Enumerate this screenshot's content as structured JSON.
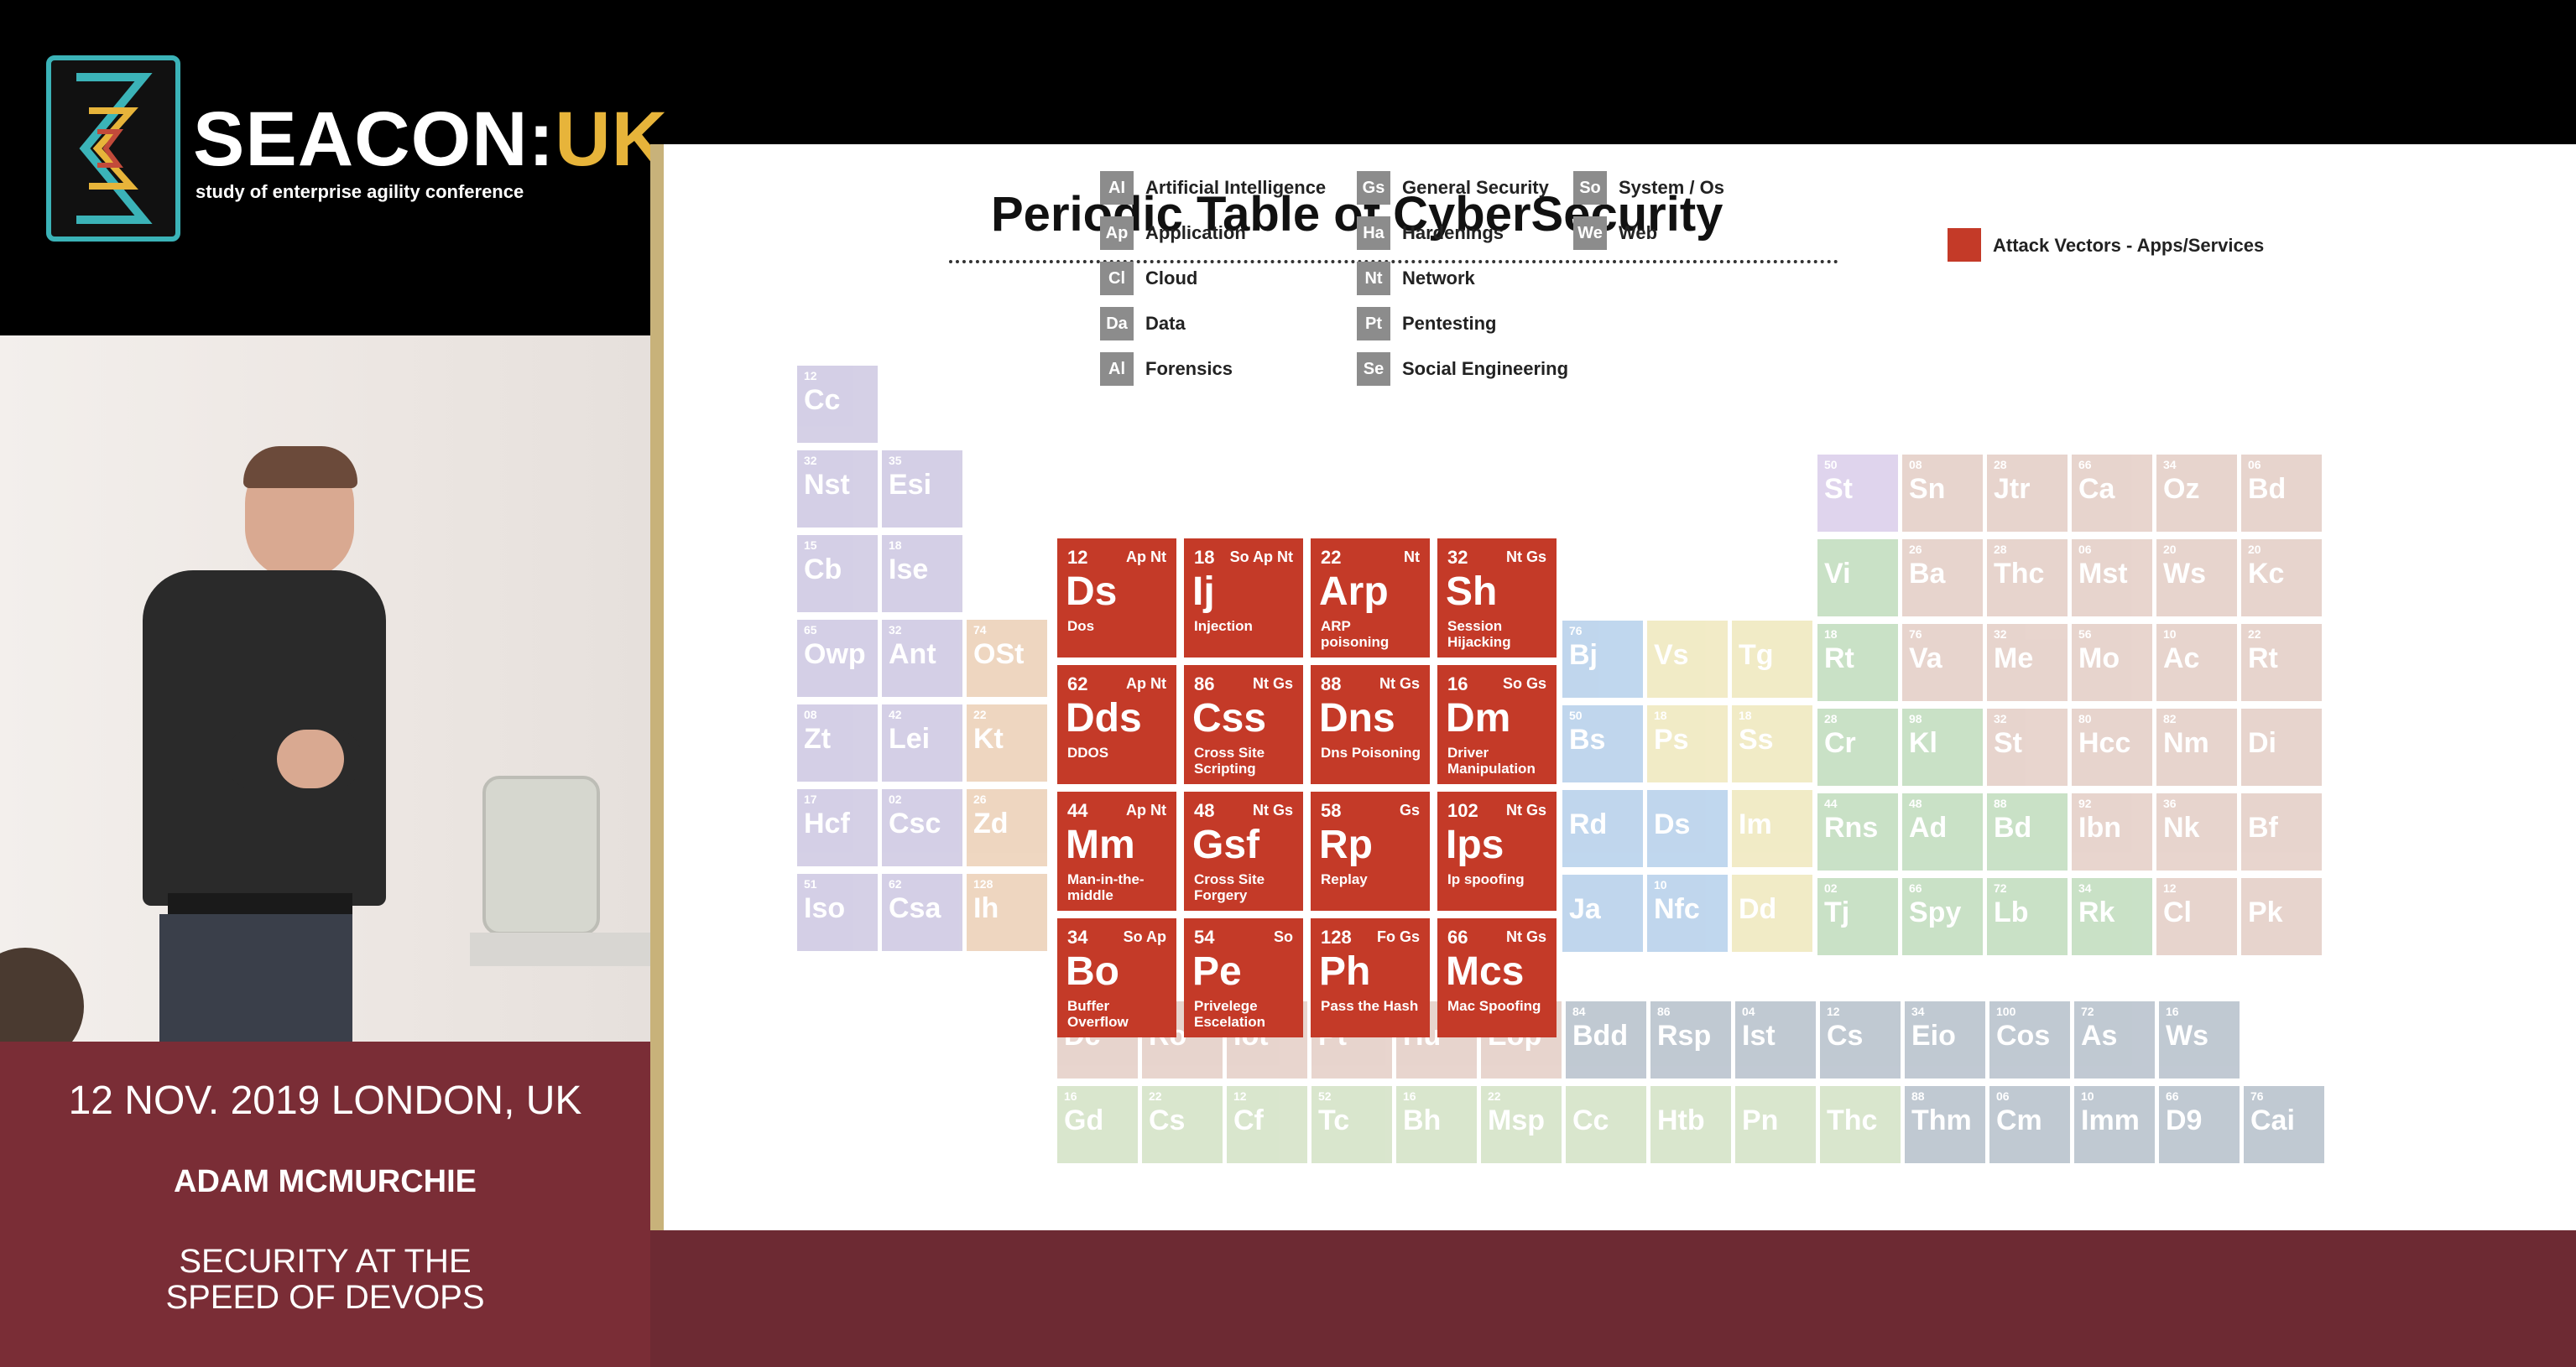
{
  "logo": {
    "brand_main": "SEACON:",
    "brand_accent": "UK",
    "tagline": "study of enterprise agility conference"
  },
  "footer": {
    "date_location": "12 NOV. 2019 LONDON, UK",
    "speaker": "ADAM MCMURCHIE",
    "talk_line1": "SECURITY AT THE",
    "talk_line2": "SPEED OF DEVOPS"
  },
  "slide": {
    "title": "Periodic Table of CyberSecurity",
    "legend_label": "Attack Vectors - Apps/Services",
    "legend_color": "#c43a28",
    "keys": [
      {
        "abbr": "AI",
        "label": "Artificial Intelligence"
      },
      {
        "abbr": "Ap",
        "label": "Application"
      },
      {
        "abbr": "Cl",
        "label": "Cloud"
      },
      {
        "abbr": "Da",
        "label": "Data"
      },
      {
        "abbr": "Al",
        "label": "Forensics"
      },
      {
        "abbr": "Gs",
        "label": "General Security"
      },
      {
        "abbr": "Ha",
        "label": "Hardenings"
      },
      {
        "abbr": "Nt",
        "label": "Network"
      },
      {
        "abbr": "Pt",
        "label": "Pentesting"
      },
      {
        "abbr": "Se",
        "label": "Social Engineering"
      },
      {
        "abbr": "So",
        "label": "System / Os"
      },
      {
        "abbr": "We",
        "label": "Web"
      }
    ],
    "attack_vectors": [
      {
        "num": "12",
        "groups": "Ap Nt",
        "sym": "Ds",
        "name": "Dos"
      },
      {
        "num": "18",
        "groups": "So Ap Nt",
        "sym": "Ij",
        "name": "Injection"
      },
      {
        "num": "22",
        "groups": "Nt",
        "sym": "Arp",
        "name": "ARP poisoning"
      },
      {
        "num": "32",
        "groups": "Nt Gs",
        "sym": "Sh",
        "name": "Session Hijacking"
      },
      {
        "num": "62",
        "groups": "Ap Nt",
        "sym": "Dds",
        "name": "DDOS"
      },
      {
        "num": "86",
        "groups": "Nt Gs",
        "sym": "Css",
        "name": "Cross Site Scripting"
      },
      {
        "num": "88",
        "groups": "Nt Gs",
        "sym": "Dns",
        "name": "Dns Poisoning"
      },
      {
        "num": "16",
        "groups": "So Gs",
        "sym": "Dm",
        "name": "Driver Manipulation"
      },
      {
        "num": "44",
        "groups": "Ap Nt",
        "sym": "Mm",
        "name": "Man-in-the-middle"
      },
      {
        "num": "48",
        "groups": "Nt Gs",
        "sym": "Gsf",
        "name": "Cross Site Forgery"
      },
      {
        "num": "58",
        "groups": "Gs",
        "sym": "Rp",
        "name": "Replay"
      },
      {
        "num": "102",
        "groups": "Nt Gs",
        "sym": "Ips",
        "name": "Ip spoofing"
      },
      {
        "num": "34",
        "groups": "So Ap",
        "sym": "Bo",
        "name": "Buffer Overflow"
      },
      {
        "num": "54",
        "groups": "So",
        "sym": "Pe",
        "name": "Privelege Escelation"
      },
      {
        "num": "128",
        "groups": "Fo Gs",
        "sym": "Ph",
        "name": "Pass the Hash"
      },
      {
        "num": "66",
        "groups": "Nt Gs",
        "sym": "Mcs",
        "name": "Mac Spoofing"
      }
    ],
    "left_elements": [
      {
        "num": "12",
        "sym": "Cc",
        "color": "#9b8fc4"
      },
      {
        "num": "32",
        "sym": "Nst",
        "color": "#9b8fc4"
      },
      {
        "num": "35",
        "sym": "Esi",
        "color": "#9b8fc4"
      },
      {
        "num": "15",
        "sym": "Cb",
        "color": "#9b8fc4"
      },
      {
        "num": "18",
        "sym": "Ise",
        "color": "#9b8fc4"
      },
      {
        "num": "65",
        "sym": "Owp",
        "color": "#9b8fc4"
      },
      {
        "num": "32",
        "sym": "Ant",
        "color": "#9b8fc4"
      },
      {
        "num": "74",
        "sym": "OSt",
        "color": "#d9a06b"
      },
      {
        "num": "08",
        "sym": "Zt",
        "color": "#9b8fc4"
      },
      {
        "num": "42",
        "sym": "Lei",
        "color": "#9b8fc4"
      },
      {
        "num": "22",
        "sym": "Kt",
        "color": "#d9a06b"
      },
      {
        "num": "17",
        "sym": "Hcf",
        "color": "#9b8fc4"
      },
      {
        "num": "02",
        "sym": "Csc",
        "color": "#9b8fc4"
      },
      {
        "num": "26",
        "sym": "Zd",
        "color": "#d9a06b"
      },
      {
        "num": "51",
        "sym": "Iso",
        "color": "#9b8fc4"
      },
      {
        "num": "62",
        "sym": "Csa",
        "color": "#9b8fc4"
      },
      {
        "num": "128",
        "sym": "Ih",
        "color": "#d9a06b"
      }
    ],
    "middle_elements": [
      {
        "num": "76",
        "sym": "Bj",
        "color": "#6aa0d6"
      },
      {
        "num": "",
        "sym": "Vs",
        "color": "#e0d07a"
      },
      {
        "num": "",
        "sym": "Tg",
        "color": "#e0d07a"
      },
      {
        "num": "50",
        "sym": "Bs",
        "color": "#6aa0d6"
      },
      {
        "num": "18",
        "sym": "Ps",
        "color": "#e0d07a"
      },
      {
        "num": "18",
        "sym": "Ss",
        "color": "#e0d07a"
      },
      {
        "num": "",
        "sym": "Rd",
        "color": "#6aa0d6"
      },
      {
        "num": "",
        "sym": "Ds",
        "color": "#6aa0d6"
      },
      {
        "num": "",
        "sym": "Im",
        "color": "#e0d07a"
      },
      {
        "num": "",
        "sym": "Ja",
        "color": "#6aa0d6"
      },
      {
        "num": "10",
        "sym": "Nfc",
        "color": "#6aa0d6"
      },
      {
        "num": "",
        "sym": "Dd",
        "color": "#e0d07a"
      }
    ],
    "right_elements": [
      {
        "num": "50",
        "sym": "St",
        "color": "#b49ad6"
      },
      {
        "num": "08",
        "sym": "Sn",
        "color": "#c89a8a"
      },
      {
        "num": "28",
        "sym": "Jtr",
        "color": "#c89a8a"
      },
      {
        "num": "66",
        "sym": "Ca",
        "color": "#c89a8a"
      },
      {
        "num": "34",
        "sym": "Oz",
        "color": "#c89a8a"
      },
      {
        "num": "06",
        "sym": "Bd",
        "color": "#c89a8a"
      },
      {
        "num": "",
        "sym": "Vi",
        "color": "#7fb87a"
      },
      {
        "num": "26",
        "sym": "Ba",
        "color": "#c89a8a"
      },
      {
        "num": "28",
        "sym": "Thc",
        "color": "#c89a8a"
      },
      {
        "num": "06",
        "sym": "Mst",
        "color": "#c89a8a"
      },
      {
        "num": "20",
        "sym": "Ws",
        "color": "#c89a8a"
      },
      {
        "num": "20",
        "sym": "Kc",
        "color": "#c89a8a"
      },
      {
        "num": "18",
        "sym": "Rt",
        "color": "#7fb87a"
      },
      {
        "num": "76",
        "sym": "Va",
        "color": "#c89a8a"
      },
      {
        "num": "32",
        "sym": "Me",
        "color": "#c89a8a"
      },
      {
        "num": "56",
        "sym": "Mo",
        "color": "#c89a8a"
      },
      {
        "num": "10",
        "sym": "Ac",
        "color": "#c89a8a"
      },
      {
        "num": "22",
        "sym": "Rt",
        "color": "#c89a8a"
      },
      {
        "num": "28",
        "sym": "Cr",
        "color": "#7fb87a"
      },
      {
        "num": "98",
        "sym": "Kl",
        "color": "#7fb87a"
      },
      {
        "num": "32",
        "sym": "St",
        "color": "#c89a8a"
      },
      {
        "num": "80",
        "sym": "Hcc",
        "color": "#c89a8a"
      },
      {
        "num": "82",
        "sym": "Nm",
        "color": "#c89a8a"
      },
      {
        "num": "",
        "sym": "Di",
        "color": "#c89a8a"
      },
      {
        "num": "44",
        "sym": "Rns",
        "color": "#7fb87a"
      },
      {
        "num": "48",
        "sym": "Ad",
        "color": "#7fb87a"
      },
      {
        "num": "88",
        "sym": "Bd",
        "color": "#7fb87a"
      },
      {
        "num": "92",
        "sym": "Ibn",
        "color": "#c89a8a"
      },
      {
        "num": "36",
        "sym": "Nk",
        "color": "#c89a8a"
      },
      {
        "num": "",
        "sym": "Bf",
        "color": "#c89a8a"
      },
      {
        "num": "02",
        "sym": "Tj",
        "color": "#7fb87a"
      },
      {
        "num": "66",
        "sym": "Spy",
        "color": "#7fb87a"
      },
      {
        "num": "72",
        "sym": "Lb",
        "color": "#7fb87a"
      },
      {
        "num": "34",
        "sym": "Rk",
        "color": "#7fb87a"
      },
      {
        "num": "12",
        "sym": "Cl",
        "color": "#c89a8a"
      },
      {
        "num": "",
        "sym": "Pk",
        "color": "#c89a8a"
      }
    ],
    "bottom_elements": [
      {
        "num": "",
        "sym": "Dc",
        "color": "#c89a8a"
      },
      {
        "num": "",
        "sym": "Ro",
        "color": "#c89a8a"
      },
      {
        "num": "",
        "sym": "Iot",
        "color": "#c89a8a"
      },
      {
        "num": "",
        "sym": "Pt",
        "color": "#c89a8a"
      },
      {
        "num": "",
        "sym": "Hu",
        "color": "#c89a8a"
      },
      {
        "num": "80",
        "sym": "Eop",
        "color": "#c89a8a"
      },
      {
        "num": "84",
        "sym": "Bdd",
        "color": "#6b7f96"
      },
      {
        "num": "86",
        "sym": "Rsp",
        "color": "#6b7f96"
      },
      {
        "num": "04",
        "sym": "Ist",
        "color": "#6b7f96"
      },
      {
        "num": "12",
        "sym": "Cs",
        "color": "#6b7f96"
      },
      {
        "num": "34",
        "sym": "Eio",
        "color": "#6b7f96"
      },
      {
        "num": "100",
        "sym": "Cos",
        "color": "#6b7f96"
      },
      {
        "num": "72",
        "sym": "As",
        "color": "#6b7f96"
      },
      {
        "num": "16",
        "sym": "Ws",
        "color": "#6b7f96"
      },
      {
        "num": "16",
        "sym": "Gd",
        "color": "#a7c48a"
      },
      {
        "num": "22",
        "sym": "Cs",
        "color": "#a7c48a"
      },
      {
        "num": "12",
        "sym": "Cf",
        "color": "#a7c48a"
      },
      {
        "num": "52",
        "sym": "Tc",
        "color": "#a7c48a"
      },
      {
        "num": "16",
        "sym": "Bh",
        "color": "#a7c48a"
      },
      {
        "num": "22",
        "sym": "Msp",
        "color": "#a7c48a"
      },
      {
        "num": "",
        "sym": "Cc",
        "color": "#a7c48a"
      },
      {
        "num": "",
        "sym": "Htb",
        "color": "#a7c48a"
      },
      {
        "num": "",
        "sym": "Pn",
        "color": "#a7c48a"
      },
      {
        "num": "",
        "sym": "Thc",
        "color": "#a7c48a"
      },
      {
        "num": "88",
        "sym": "Thm",
        "color": "#6b7f96"
      },
      {
        "num": "06",
        "sym": "Cm",
        "color": "#6b7f96"
      },
      {
        "num": "10",
        "sym": "Imm",
        "color": "#6b7f96"
      },
      {
        "num": "66",
        "sym": "D9",
        "color": "#6b7f96"
      },
      {
        "num": "76",
        "sym": "Cai",
        "color": "#6b7f96"
      }
    ]
  }
}
